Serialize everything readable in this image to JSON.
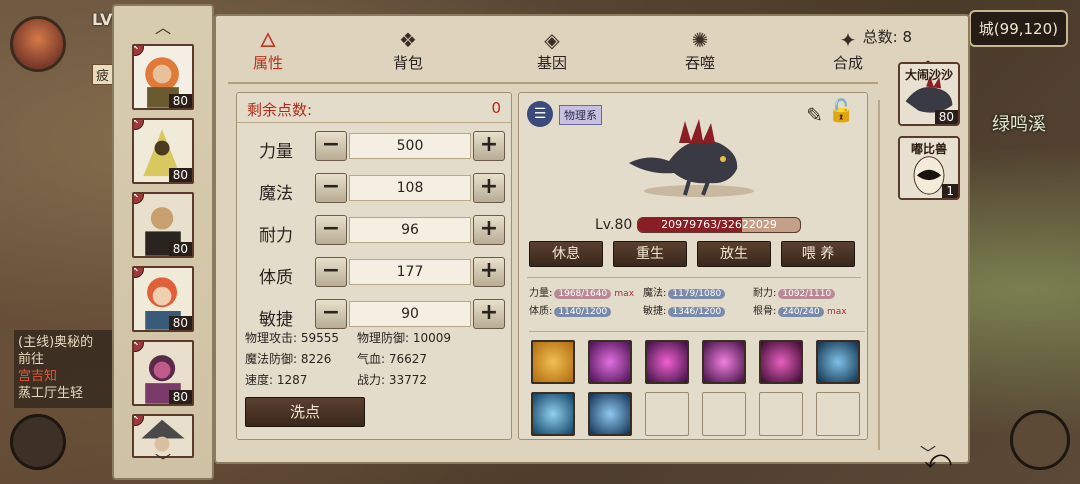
{
  "hud": {
    "level_prefix": "LV",
    "status_tag": "疲",
    "city": "城(99,120)",
    "place": "绿鸣溪",
    "quest_line1": "(主线)奥秘的",
    "quest_line2": "前往",
    "quest_line3": "宫吉知",
    "quest_line4": "蒸工厅生轻"
  },
  "heroes": [
    {
      "level": "80"
    },
    {
      "level": "80"
    },
    {
      "level": "80"
    },
    {
      "level": "80"
    },
    {
      "level": "80"
    }
  ],
  "tabs": [
    {
      "label": "属性",
      "icon": "flame-icon"
    },
    {
      "label": "背包",
      "icon": "bag-icon"
    },
    {
      "label": "基因",
      "icon": "gene-icon"
    },
    {
      "label": "吞噬",
      "icon": "devour-icon"
    },
    {
      "label": "合成",
      "icon": "merge-icon"
    }
  ],
  "total_label": "总数: 8",
  "pets": [
    {
      "name": "大闹沙沙",
      "level": "80"
    },
    {
      "name": "嘟比兽",
      "level": "1"
    }
  ],
  "attributes": {
    "remaining_label": "剩余点数:",
    "remaining_value": "0",
    "stats": [
      {
        "name": "力量",
        "value": "500"
      },
      {
        "name": "魔法",
        "value": "108"
      },
      {
        "name": "耐力",
        "value": "96"
      },
      {
        "name": "体质",
        "value": "177"
      },
      {
        "name": "敏捷",
        "value": "90"
      }
    ],
    "derived": {
      "phys_atk": "物理攻击: 59555",
      "phys_def": "物理防御: 10009",
      "mag_def": "魔法防御: 8226",
      "hp": "气血: 76627",
      "speed": "速度: 1287",
      "power": "战力: 33772"
    },
    "reset_label": "洗点"
  },
  "pet_panel": {
    "type_label": "物理系",
    "level": "Lv.80",
    "exp_text": "20979763/32622029",
    "exp_fraction": 0.643,
    "buttons": [
      "休息",
      "重生",
      "放生",
      "喂 养"
    ],
    "stats": {
      "str_label": "力量:",
      "str_val": "1968/1640",
      "max": "max",
      "mag_label": "魔法:",
      "mag_val": "1179/1080",
      "end_label": "耐力:",
      "end_val": "1092/1110",
      "con_label": "体质:",
      "con_val": "1140/1200",
      "agi_label": "敏捷:",
      "agi_val": "1346/1200",
      "root_label": "根骨:",
      "root_val": "240/240"
    }
  },
  "colors": {
    "accent_red": "#b02a1a",
    "button_dark": "#3a281c"
  }
}
